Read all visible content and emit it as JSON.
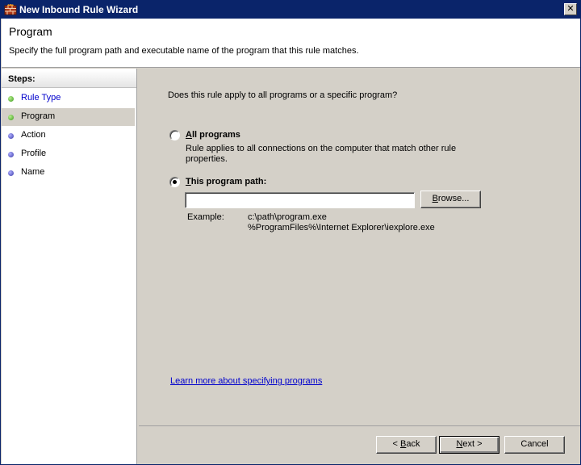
{
  "window": {
    "title": "New Inbound Rule Wizard",
    "close_glyph": "✕"
  },
  "header": {
    "title": "Program",
    "subtitle": "Specify the full program path and executable name of the program that this rule matches."
  },
  "sidebar": {
    "steps_title": "Steps:",
    "items": [
      {
        "label": "Rule Type",
        "state": "done"
      },
      {
        "label": "Program",
        "state": "current"
      },
      {
        "label": "Action",
        "state": "pending"
      },
      {
        "label": "Profile",
        "state": "pending"
      },
      {
        "label": "Name",
        "state": "pending"
      }
    ]
  },
  "main": {
    "question": "Does this rule apply to all programs or a specific program?",
    "options": {
      "all_programs": {
        "label_accel": "A",
        "label_rest": "ll programs",
        "description": "Rule applies to all connections on the computer that match other rule properties.",
        "selected": false
      },
      "program_path": {
        "label_accel": "T",
        "label_rest": "his program path:",
        "selected": true,
        "value": "",
        "placeholder": ""
      }
    },
    "browse_button": {
      "accel": "B",
      "rest": "rowse..."
    },
    "example_label": "Example:",
    "example_lines": [
      "c:\\path\\program.exe",
      "%ProgramFiles%\\Internet Explorer\\iexplore.exe"
    ],
    "learn_more": "Learn more about specifying programs"
  },
  "footer": {
    "back": {
      "prefix": "< ",
      "accel": "B",
      "rest": "ack"
    },
    "next": {
      "accel": "N",
      "rest": "ext >"
    },
    "cancel": "Cancel"
  },
  "colors": {
    "titlebar": "#0a246a",
    "dialog": "#d4d0c8",
    "link": "#0000cc",
    "step_done": "#3a9a1a",
    "step_pending": "#3838a8"
  }
}
